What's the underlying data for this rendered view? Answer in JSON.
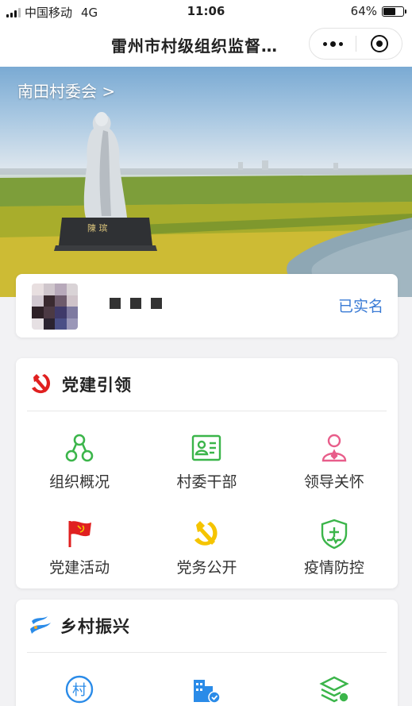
{
  "status_bar": {
    "carrier": "中国移动",
    "network": "4G",
    "time": "11:06",
    "battery": "64%",
    "battery_level": 0.64
  },
  "nav": {
    "title": "雷州市村级组织监督…"
  },
  "hero": {
    "village_link": "南田村委会 >",
    "statue_plaque": "陳 瑸"
  },
  "user": {
    "name_masked": "■ ■ ■",
    "verify_status": "已实名"
  },
  "party": {
    "title": "党建引领",
    "items": [
      {
        "label": "组织概况",
        "icon": "org-structure-icon",
        "color": "#3bb54a"
      },
      {
        "label": "村委干部",
        "icon": "id-card-icon",
        "color": "#3bb54a"
      },
      {
        "label": "领导关怀",
        "icon": "person-care-icon",
        "color": "#e85d8a"
      },
      {
        "label": "党建活动",
        "icon": "party-flag-icon",
        "color": "#e02020"
      },
      {
        "label": "党务公开",
        "icon": "hammer-sickle-icon",
        "color": "#f5c400"
      },
      {
        "label": "疫情防控",
        "icon": "shield-medical-icon",
        "color": "#3bb54a"
      }
    ]
  },
  "rural": {
    "title": "乡村振兴",
    "items": [
      {
        "label": "",
        "icon": "village-badge-icon",
        "glyph": "村",
        "color": "#2a8be8"
      },
      {
        "label": "",
        "icon": "building-check-icon",
        "color": "#2a8be8"
      },
      {
        "label": "",
        "icon": "layers-gear-icon",
        "color": "#3bb54a"
      }
    ]
  },
  "colors": {
    "accent_blue": "#3a7bd5",
    "party_red": "#e02020"
  }
}
